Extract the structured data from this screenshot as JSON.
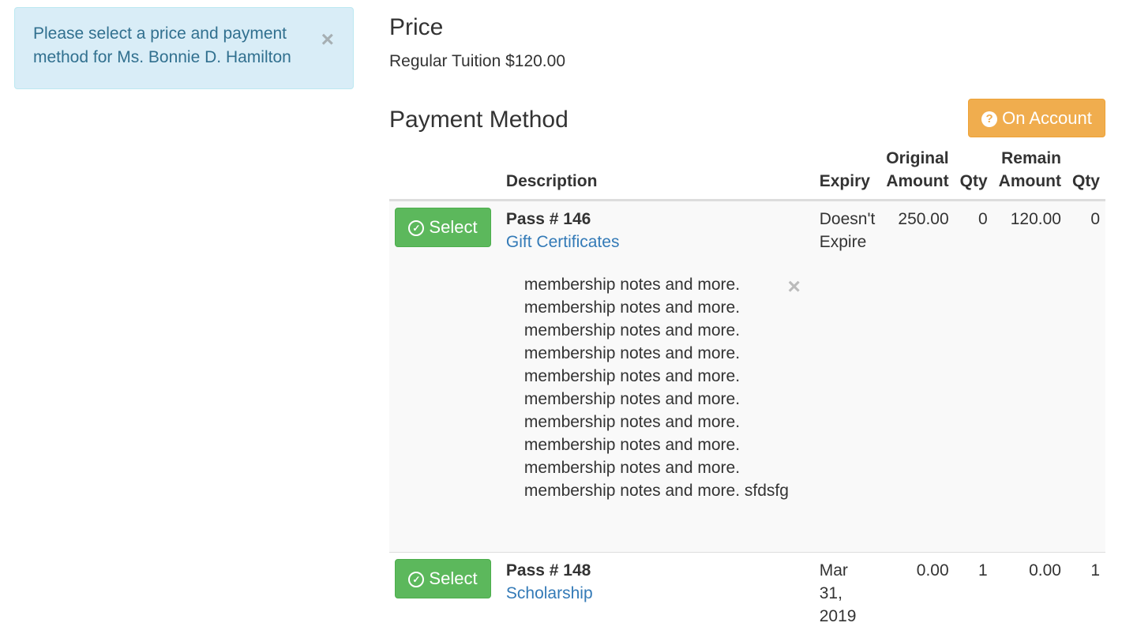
{
  "alert": {
    "message": "Please select a price and payment method for Ms. Bonnie D. Hamilton",
    "close_glyph": "×"
  },
  "price": {
    "title": "Price",
    "value": "Regular Tuition $120.00"
  },
  "payment_method": {
    "title": "Payment Method",
    "on_account_label": "On Account",
    "on_account_icon": "question-circle-icon",
    "columns": {
      "description": "Description",
      "expiry": "Expiry",
      "original_amount_1": "Original",
      "original_amount_2": "Amount",
      "qty": "Qty",
      "remain_amount_1": "Remain",
      "remain_amount_2": "Amount",
      "remain_qty": "Qty"
    },
    "rows": [
      {
        "select_label": "Select",
        "pass": "Pass # 146",
        "type": "Gift Certificates",
        "expiry_1": "Doesn't",
        "expiry_2": "Expire",
        "original_amount": "250.00",
        "qty": "0",
        "remain_amount": "120.00",
        "remain_qty": "0",
        "notes": [
          "membership notes and more.",
          "membership notes and more.",
          "membership notes and more.",
          "membership notes and more.",
          "membership notes and more.",
          "membership notes and more.",
          "membership notes and more.",
          "membership notes and more.",
          "membership notes and more.",
          "membership notes and more. sfdsfg"
        ]
      },
      {
        "select_label": "Select",
        "pass": "Pass # 148",
        "type": "Scholarship",
        "expiry_1": "Mar 31,",
        "expiry_2": "2019",
        "original_amount": "0.00",
        "qty": "1",
        "remain_amount": "0.00",
        "remain_qty": "1"
      }
    ]
  },
  "colors": {
    "info_bg": "#d9edf7",
    "info_text": "#31708f",
    "warning": "#f0ad4e",
    "success": "#5cb85c",
    "link": "#337ab7"
  }
}
